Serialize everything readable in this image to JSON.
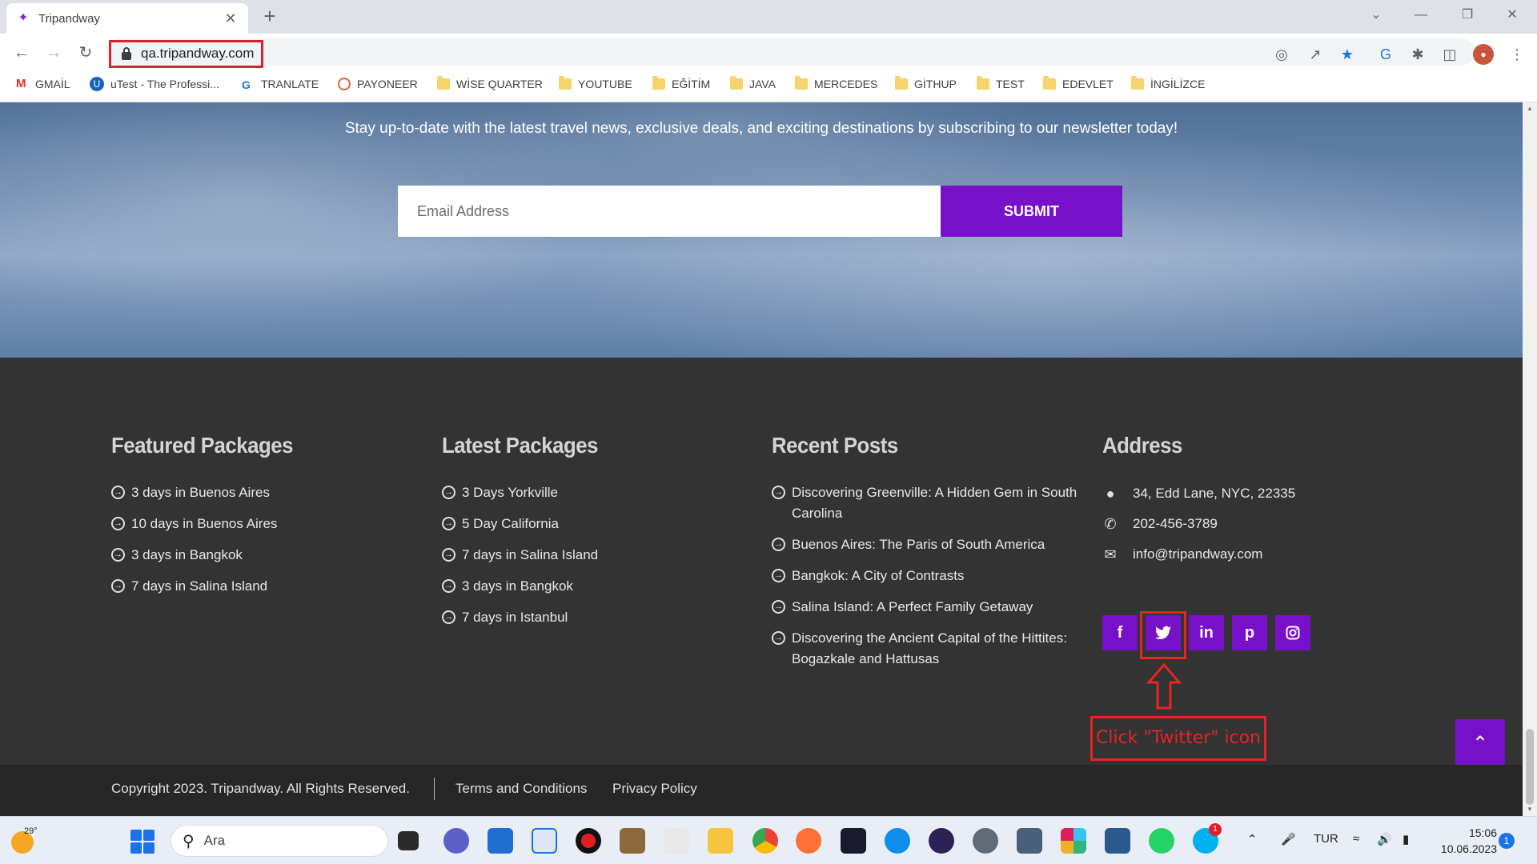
{
  "browser": {
    "tab_title": "Tripandway",
    "url": "qa.tripandway.com",
    "bookmarks": [
      "GMAİL",
      "uTest - The Professi...",
      "TRANLATE",
      "PAYONEER",
      "WİSE QUARTER",
      "YOUTUBE",
      "EĞİTİM",
      "JAVA",
      "MERCEDES",
      "GİTHUP",
      "TEST",
      "EDEVLET",
      "İNGİLİZCE"
    ]
  },
  "newsletter": {
    "text": "Stay up-to-date with the latest travel news, exclusive deals, and exciting destinations by subscribing to our newsletter today!",
    "email_placeholder": "Email Address",
    "submit_label": "SUBMIT"
  },
  "footer": {
    "featured": {
      "title": "Featured Packages",
      "items": [
        "3 days in Buenos Aires",
        "10 days in Buenos Aires",
        "3 days in Bangkok",
        "7 days in Salina Island"
      ]
    },
    "latest": {
      "title": "Latest Packages",
      "items": [
        "3 Days Yorkville",
        "5 Day California",
        "7 days in Salina Island",
        "3 days in Bangkok",
        "7 days in Istanbul"
      ]
    },
    "recent": {
      "title": "Recent Posts",
      "items": [
        "Discovering Greenville: A Hidden Gem in South Carolina",
        "Buenos Aires: The Paris of South America",
        "Bangkok: A City of Contrasts",
        "Salina Island: A Perfect Family Getaway",
        "Discovering the Ancient Capital of the Hittites: Bogazkale and Hattusas"
      ]
    },
    "address": {
      "title": "Address",
      "street": "34, Edd Lane, NYC, 22335",
      "phone": "202-456-3789",
      "email": "info@tripandway.com"
    },
    "socials": [
      "facebook-icon",
      "twitter-icon",
      "linkedin-icon",
      "pinterest-icon",
      "instagram-icon"
    ],
    "annotation": "Click \"Twitter\" icon",
    "copyright": "Copyright 2023. Tripandway. All Rights Reserved.",
    "terms": "Terms and Conditions",
    "privacy": "Privacy Policy"
  },
  "taskbar": {
    "temperature": "29°",
    "search_placeholder": "Ara",
    "language": "TUR",
    "time": "15:06",
    "date": "10.06.2023",
    "notifications": "1",
    "skype_badge": "1"
  },
  "colors": {
    "brand": "#7710c9",
    "footer_bg": "#333333",
    "annotation": "#e52424"
  }
}
